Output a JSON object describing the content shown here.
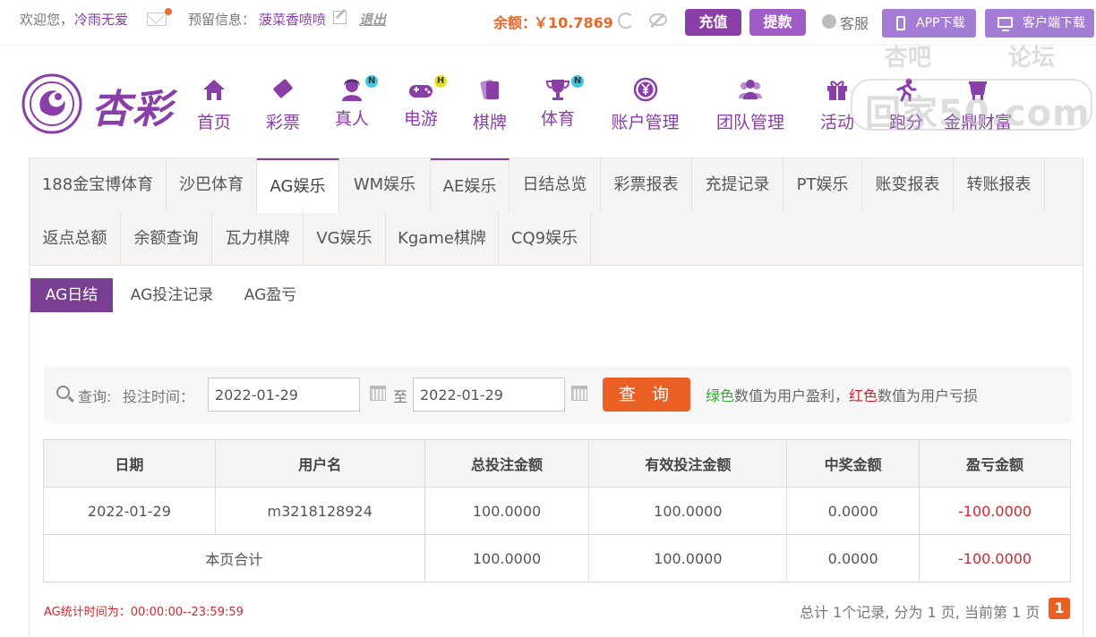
{
  "topbar": {
    "welcome": "欢迎您，",
    "username": "冷雨无爱",
    "reserved_label": "预留信息：",
    "reserved_value": "菠菜香喷喷",
    "logout": "退出",
    "balance_label": "余额：",
    "balance_value": "￥10.7869",
    "recharge": "充值",
    "withdraw": "提款",
    "customer_service": "客服",
    "app_download": "APP下载",
    "client_download": "客户端下载"
  },
  "brand": {
    "name": "杏彩"
  },
  "watermark": {
    "left": "杏吧",
    "right": "论坛",
    "main": "回家50.com"
  },
  "nav": [
    {
      "label": "首页",
      "icon": "home-icon"
    },
    {
      "label": "彩票",
      "icon": "ticket-icon"
    },
    {
      "label": "真人",
      "icon": "dealer-icon",
      "badge": "N"
    },
    {
      "label": "电游",
      "icon": "gamepad-icon",
      "badge": "H"
    },
    {
      "label": "棋牌",
      "icon": "cards-icon"
    },
    {
      "label": "体育",
      "icon": "trophy-icon",
      "badge": "N"
    },
    {
      "label": "账户管理",
      "icon": "yen-coin-icon"
    },
    {
      "label": "团队管理",
      "icon": "team-icon"
    },
    {
      "label": "活动",
      "icon": "gift-icon"
    },
    {
      "label": "跑分",
      "icon": "run-icon"
    },
    {
      "label": "金鼎财富",
      "icon": "wealth-icon"
    }
  ],
  "tabs_row1": [
    "188金宝博体育",
    "沙巴体育",
    "AG娱乐",
    "WM娱乐",
    "AE娱乐",
    "日结总览",
    "彩票报表",
    "充提记录",
    "PT娱乐",
    "账变报表",
    "转账报表"
  ],
  "tabs_row2": [
    "返点总额",
    "余额查询",
    "瓦力棋牌",
    "VG娱乐",
    "Kgame棋牌",
    "CQ9娱乐"
  ],
  "subtabs": [
    "AG日结",
    "AG投注记录",
    "AG盈亏"
  ],
  "query": {
    "label": "查询:",
    "time_label": "投注时间：",
    "start_date": "2022-01-29",
    "to": "至",
    "end_date": "2022-01-29",
    "button": "查 询",
    "legend_green": "绿色",
    "legend_mid": "数值为用户盈利，",
    "legend_red": "红色",
    "legend_end": "数值为用户亏损"
  },
  "table": {
    "headers": [
      "日期",
      "用户名",
      "总投注金额",
      "有效投注金额",
      "中奖金额",
      "盈亏金额"
    ],
    "rows": [
      [
        "2022-01-29",
        "m3218128924",
        "100.0000",
        "100.0000",
        "0.0000",
        "-100.0000"
      ]
    ],
    "total_label": "本页合计",
    "totals": [
      "100.0000",
      "100.0000",
      "0.0000",
      "-100.0000"
    ]
  },
  "footer": {
    "stat_time": "AG统计时间为：00:00:00--23:59:59",
    "pager": "总计 1个记录, 分为 1 页, 当前第 1 页",
    "current_page": "1"
  },
  "colors": {
    "brand_purple": "#8a3ea8",
    "accent_orange": "#ea5f24",
    "loss_red": "#d4262c",
    "profit_green": "#3aa63a"
  }
}
